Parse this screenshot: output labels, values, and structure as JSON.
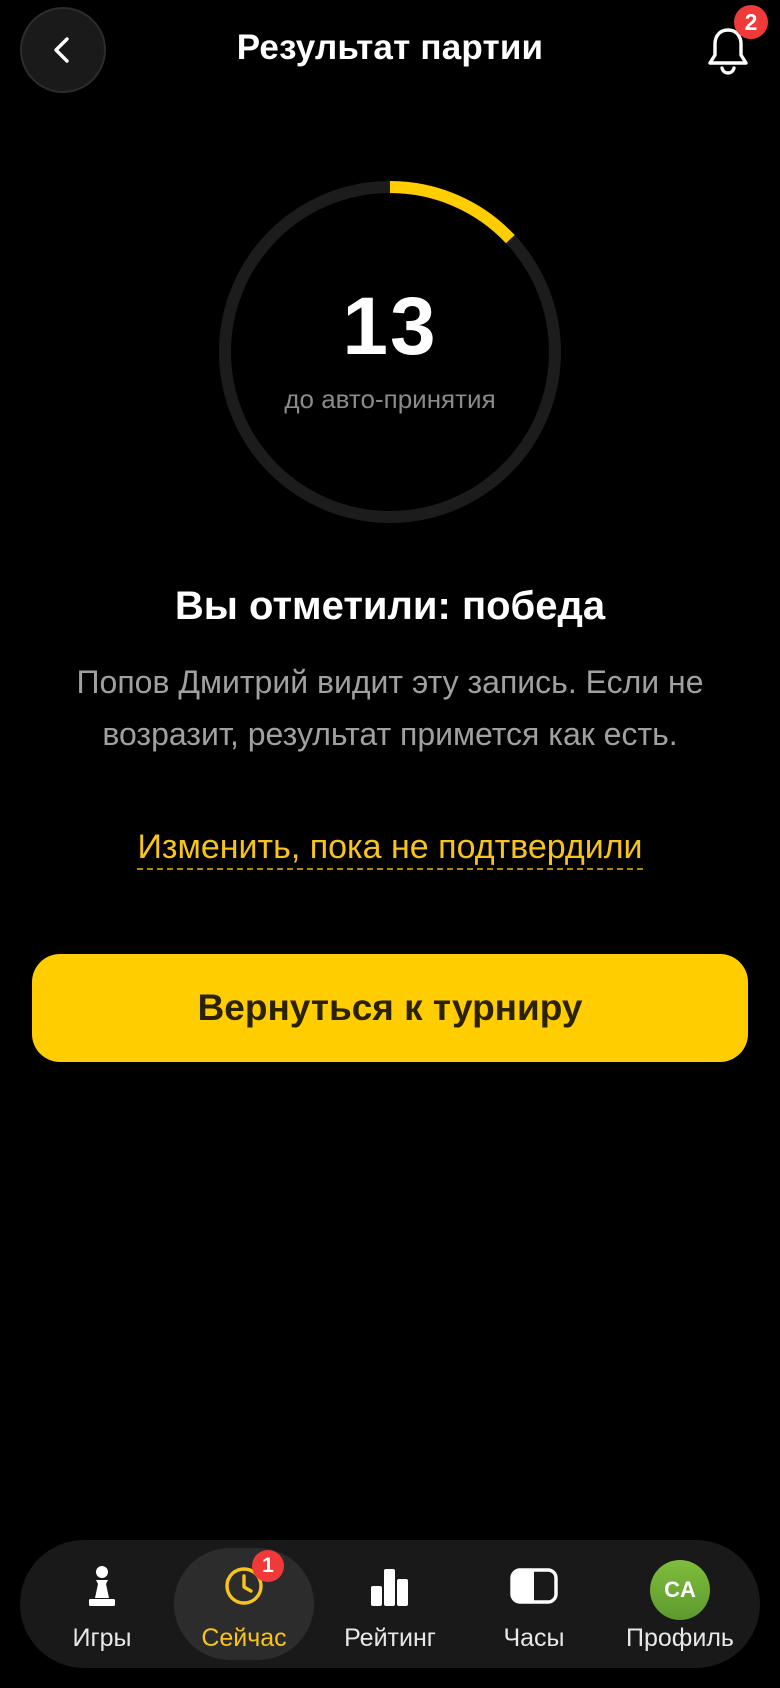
{
  "header": {
    "title": "Результат партии",
    "notifications_count": "2"
  },
  "timer": {
    "value": "13",
    "caption": "до авто-принятия",
    "progress_fraction": 0.13,
    "accent_color": "#ffcd00",
    "track_color": "#1c1c1c"
  },
  "result": {
    "title": "Вы отметили: победа",
    "description": "Попов Дмитрий видит эту запись. Если не возразит, результат примется как есть.",
    "change_link": "Изменить, пока не подтвердили"
  },
  "actions": {
    "return_label": "Вернуться к турниру"
  },
  "tabbar": {
    "tabs": [
      {
        "label": "Игры",
        "icon": "pawn-icon"
      },
      {
        "label": "Сейчас",
        "icon": "clock-icon",
        "badge": "1",
        "active": true
      },
      {
        "label": "Рейтинг",
        "icon": "bar-chart-icon"
      },
      {
        "label": "Часы",
        "icon": "chess-clock-icon"
      },
      {
        "label": "Профиль",
        "icon": "avatar",
        "avatar_initials": "CA"
      }
    ]
  },
  "colors": {
    "accent": "#ffcd00",
    "badge": "#f03a3a",
    "background": "#000000"
  }
}
